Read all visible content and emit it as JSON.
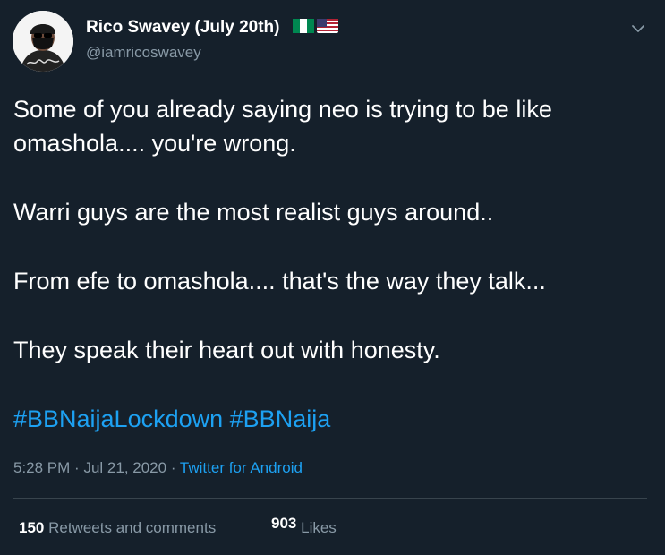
{
  "author": {
    "name": "Rico Swavey (July 20th)",
    "handle": "@iamricoswavey",
    "avatar_icon": "profile-photo",
    "flags": [
      "nigeria-flag-icon",
      "usa-flag-icon"
    ],
    "avatar_signature": "Rico Swavey"
  },
  "tweet": {
    "lines": [
      "Some  of you already saying neo is trying to be like omashola.... you're wrong.",
      "Warri guys are the most realist guys around..",
      "From efe to omashola.... that's the way they talk...",
      "They speak their heart out with honesty."
    ],
    "hashtags": [
      "#BBNaijaLockdown",
      "#BBNaija"
    ]
  },
  "meta": {
    "time": "5:28 PM",
    "separator": "·",
    "date": "Jul 21, 2020",
    "source": "Twitter for Android"
  },
  "stats": {
    "retweets_count": "150",
    "retweets_label": "Retweets and comments",
    "likes_count": "903",
    "likes_label": "Likes"
  },
  "colors": {
    "background": "#15202b",
    "text": "#ffffff",
    "secondary": "#8899a6",
    "link": "#1da1f2",
    "divider": "#38444d"
  }
}
